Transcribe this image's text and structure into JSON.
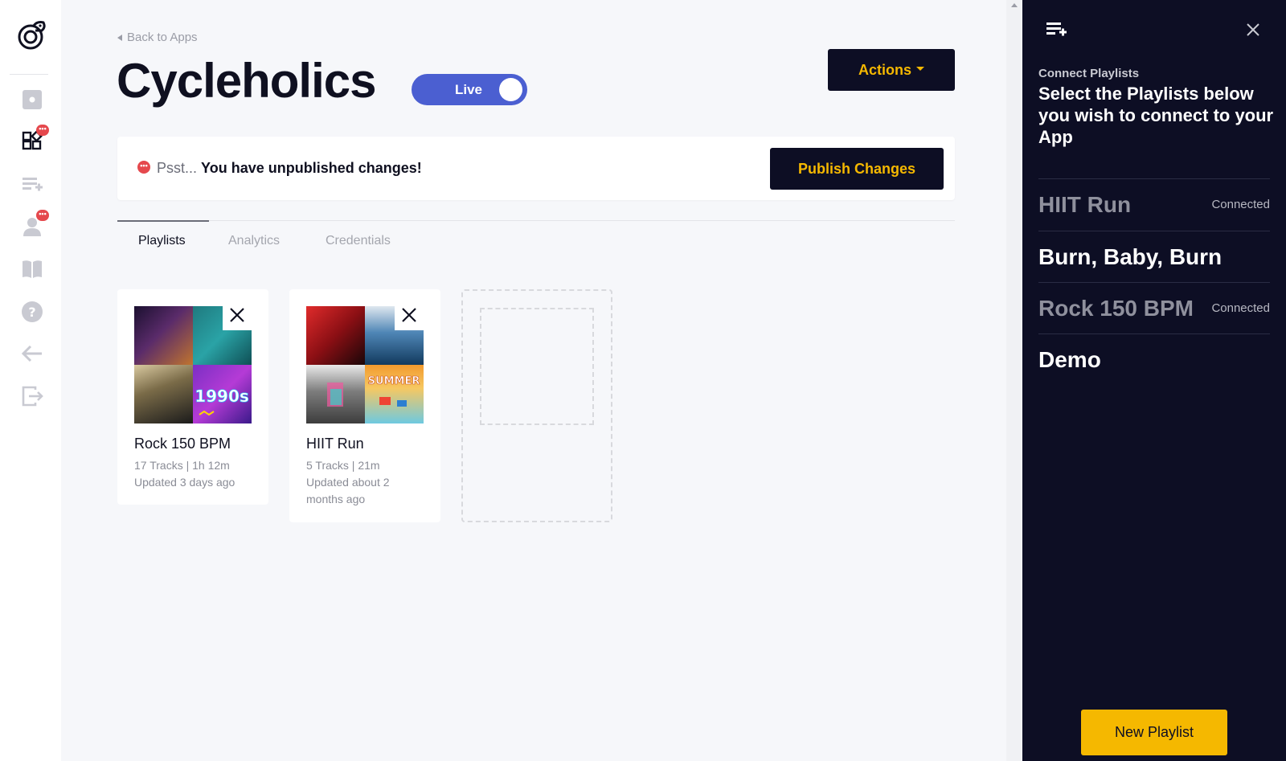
{
  "nav": {
    "back_label": "Back to Apps"
  },
  "app": {
    "title": "Cycleholics",
    "status_toggle_label": "Live",
    "actions_label": "Actions"
  },
  "notice": {
    "prefix": "Psst...",
    "message": "You have unpublished changes!",
    "publish_label": "Publish Changes"
  },
  "tabs": [
    {
      "label": "Playlists",
      "active": true
    },
    {
      "label": "Analytics",
      "active": false
    },
    {
      "label": "Credentials",
      "active": false
    }
  ],
  "playlists": [
    {
      "name": "Rock 150 BPM",
      "meta": "17 Tracks | 1h 12m",
      "updated": "Updated 3 days ago"
    },
    {
      "name": "HIIT Run",
      "meta": "5 Tracks | 21m",
      "updated": "Updated about 2 months ago"
    }
  ],
  "panel": {
    "subtitle": "Connect Playlists",
    "heading": "Select the Playlists below you wish to connect to your App",
    "items": [
      {
        "name": "HIIT Run",
        "status": "Connected"
      },
      {
        "name": "Burn, Baby, Burn",
        "status": ""
      },
      {
        "name": "Rock 150 BPM",
        "status": "Connected"
      },
      {
        "name": "Demo",
        "status": ""
      }
    ],
    "new_playlist_label": "New Playlist"
  },
  "badges": {
    "dots": "•••"
  },
  "colors": {
    "accent": "#f5b800",
    "navy": "#0d0e24",
    "toggle": "#4b5fd1",
    "alert": "#e5484d"
  }
}
